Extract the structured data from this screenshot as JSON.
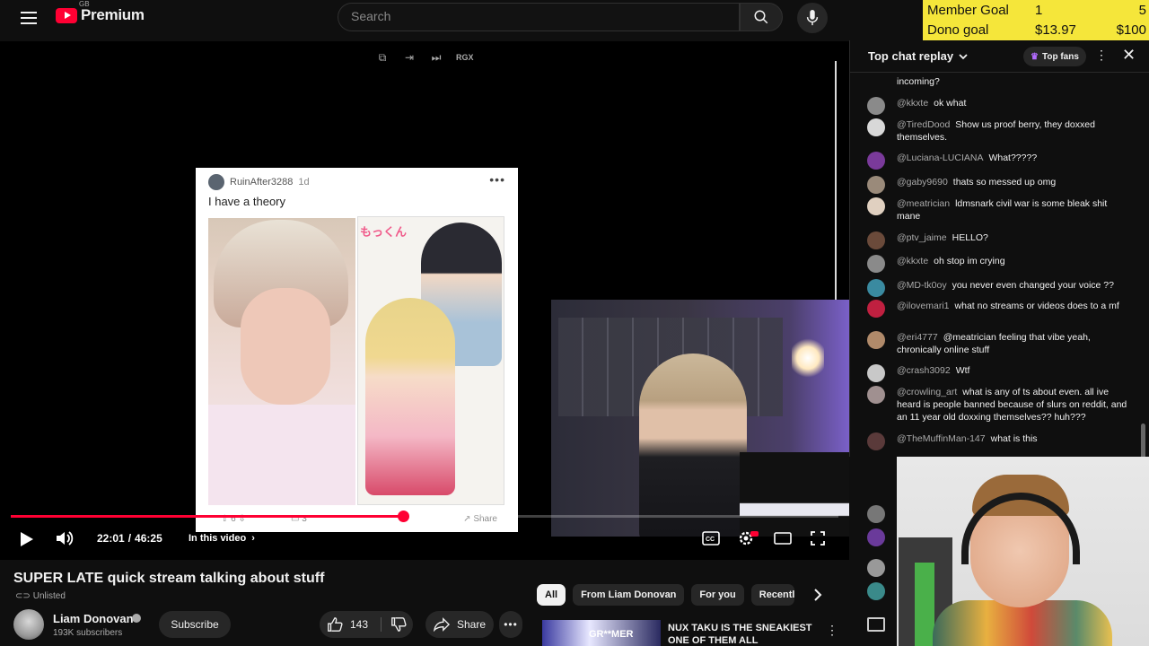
{
  "header": {
    "logo_text": "Premium",
    "logo_region": "GB",
    "search_placeholder": "Search"
  },
  "goal_overlay": {
    "rows": [
      {
        "label": "Member Goal",
        "current": "1",
        "target": "5"
      },
      {
        "label": "Dono goal",
        "current": "$13.97",
        "target": "$100"
      }
    ],
    "background": "#f5e63a"
  },
  "player": {
    "toolbar_rgx": "RGX",
    "post": {
      "username": "RuinAfter3288",
      "age": "1d",
      "title": "I have a theory",
      "image_tag": "もっくん",
      "votes": "6",
      "comments": "3",
      "share_label": "Share"
    },
    "controls": {
      "current_time": "22:01",
      "duration": "46:25",
      "in_this_video": "In this video"
    },
    "progress_fraction": 0.474,
    "accent": "#ff0033"
  },
  "video": {
    "title": "SUPER LATE quick stream talking about stuff",
    "visibility": "Unlisted",
    "channel_name": "Liam Donovan",
    "subscribers": "193K subscribers",
    "subscribe_label": "Subscribe",
    "likes": "143",
    "share_label": "Share"
  },
  "chips": [
    "All",
    "From Liam Donovan",
    "For you",
    "Recently"
  ],
  "recommendation": {
    "thumb_text": "GR**MER",
    "title": "NUX TAKU IS THE SNEAKIEST ONE OF THEM ALL"
  },
  "chat": {
    "title": "Top chat replay",
    "top_fans_label": "Top fans",
    "messages": [
      {
        "author": "",
        "text": "incoming?",
        "color": "#777777"
      },
      {
        "author": "@kkxte",
        "text": "ok what",
        "color": "#8a8a8a"
      },
      {
        "author": "@TiredDood",
        "text": "Show us proof berry, they doxxed themselves.",
        "color": "#d8d8d8"
      },
      {
        "author": "@Luciana-LUCIANA",
        "text": "What?????",
        "color": "#7a3a9a"
      },
      {
        "author": "@gaby9690",
        "text": "thats so messed up omg",
        "color": "#9a8a7a"
      },
      {
        "author": "@meatrician",
        "text": "ldmsnark civil war is some bleak shit mane",
        "color": "#e0d0c0"
      },
      {
        "author": "@ptv_jaime",
        "text": "HELLO?",
        "color": "#6a4a3a"
      },
      {
        "author": "@kkxte",
        "text": "oh stop im crying",
        "color": "#8a8a8a"
      },
      {
        "author": "@MD-tk0oy",
        "text": "you never even changed your voice ??",
        "color": "#3a8aa0"
      },
      {
        "author": "@ilovemari1",
        "text": "what no streams or videos does to a mf",
        "color": "#c02040"
      },
      {
        "author": "@eri4777",
        "text": "@meatrician feeling that vibe yeah, chronically online stuff",
        "color": "#b08a6a"
      },
      {
        "author": "@crash3092",
        "text": "Wtf",
        "color": "#c8c8c8"
      },
      {
        "author": "@crowling_art",
        "text": "what is any of ts about even. all ive heard is people banned because of slurs on reddit, and an 11 year old doxxing themselves?? huh???",
        "color": "#a09090"
      },
      {
        "author": "@TheMuffinMan-147",
        "text": "what is this",
        "color": "#5a3a3a"
      }
    ]
  }
}
